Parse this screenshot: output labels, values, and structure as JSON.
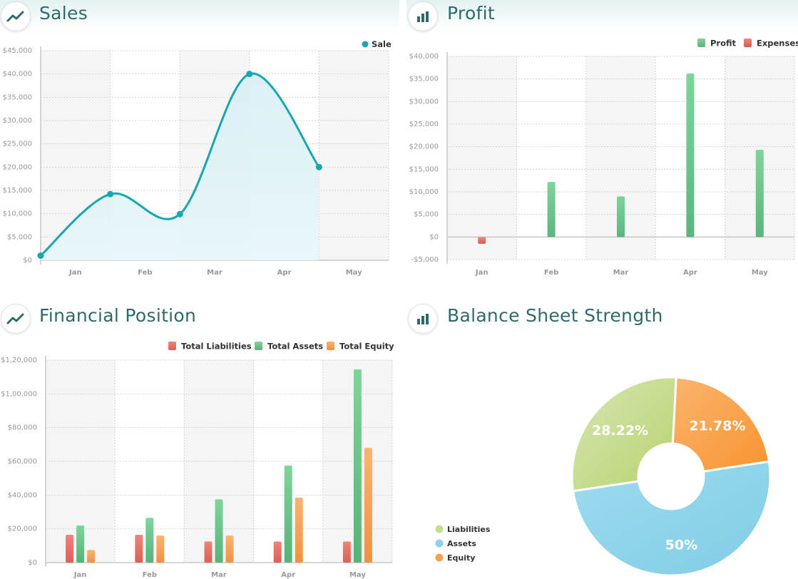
{
  "panels": {
    "sales": {
      "title": "Sales",
      "icon": "line-chart-icon"
    },
    "profit": {
      "title": "Profit",
      "icon": "bar-chart-icon"
    },
    "financial": {
      "title": "Financial Position",
      "icon": "line-chart-icon"
    },
    "balance": {
      "title": "Balance Sheet Strength",
      "icon": "bar-chart-icon"
    }
  },
  "colors": {
    "sale": "#17a6b3",
    "profit": "#6cc78d",
    "expenses": "#e8746a",
    "liabilities": "#e8746a",
    "assets": "#6cc78d",
    "equity": "#f5a55c",
    "pie_liabilities": "#c4dc8e",
    "pie_assets": "#8ad2ea",
    "pie_equity": "#f9a150"
  },
  "chart_data": [
    {
      "id": "sales",
      "type": "area",
      "categories": [
        "Jan",
        "Feb",
        "Mar",
        "Apr",
        "May"
      ],
      "series": [
        {
          "name": "Sale",
          "x": [
            0,
            1,
            2,
            3,
            4
          ],
          "values": [
            1000,
            14200,
            9900,
            40000,
            20000
          ]
        }
      ],
      "ylim": [
        0,
        45000
      ],
      "yticks": [
        "$0",
        "$5,000",
        "$10,000",
        "$15,000",
        "$20,000",
        "$25,000",
        "$30,000",
        "$35,000",
        "$40,000",
        "$45,000"
      ],
      "legend": "top-right",
      "grid": true
    },
    {
      "id": "profit",
      "type": "bar",
      "categories": [
        "Jan",
        "Feb",
        "Mar",
        "Apr",
        "May"
      ],
      "series": [
        {
          "name": "Profit",
          "values": [
            0,
            12200,
            9000,
            36200,
            19300
          ]
        },
        {
          "name": "Expenses",
          "values": [
            -1500,
            0,
            0,
            0,
            0
          ]
        }
      ],
      "ylim": [
        -5000,
        40000
      ],
      "yticks": [
        "-$5,000",
        "$0",
        "$5,000",
        "$10,000",
        "$15,000",
        "$20,000",
        "$25,000",
        "$30,000",
        "$35,000",
        "$40,000"
      ],
      "legend": "top-right",
      "grid": true
    },
    {
      "id": "financial",
      "type": "bar",
      "categories": [
        "Jan",
        "Feb",
        "Mar",
        "Apr",
        "May"
      ],
      "series": [
        {
          "name": "Total Liabilities",
          "values": [
            16500,
            16500,
            12500,
            12500,
            12500
          ]
        },
        {
          "name": "Total Assets",
          "values": [
            22000,
            26500,
            37500,
            57500,
            114500
          ]
        },
        {
          "name": "Total Equity",
          "values": [
            7500,
            16000,
            16000,
            38500,
            68000
          ]
        }
      ],
      "ylim": [
        0,
        120000
      ],
      "yticks": [
        "$0",
        "$20,000",
        "$40,000",
        "$60,000",
        "$80,000",
        "$1,00,000",
        "$1,20,000"
      ],
      "legend": "top-right",
      "grid": true
    },
    {
      "id": "balance",
      "type": "pie",
      "slices": [
        {
          "name": "Liabilities",
          "value": 28.22,
          "label": "28.22%"
        },
        {
          "name": "Equity",
          "value": 21.78,
          "label": "21.78%"
        },
        {
          "name": "Assets",
          "value": 50,
          "label": "50%"
        }
      ],
      "legend_items": [
        "Liabilities",
        "Assets",
        "Equity"
      ],
      "legend": "bottom-left"
    }
  ]
}
